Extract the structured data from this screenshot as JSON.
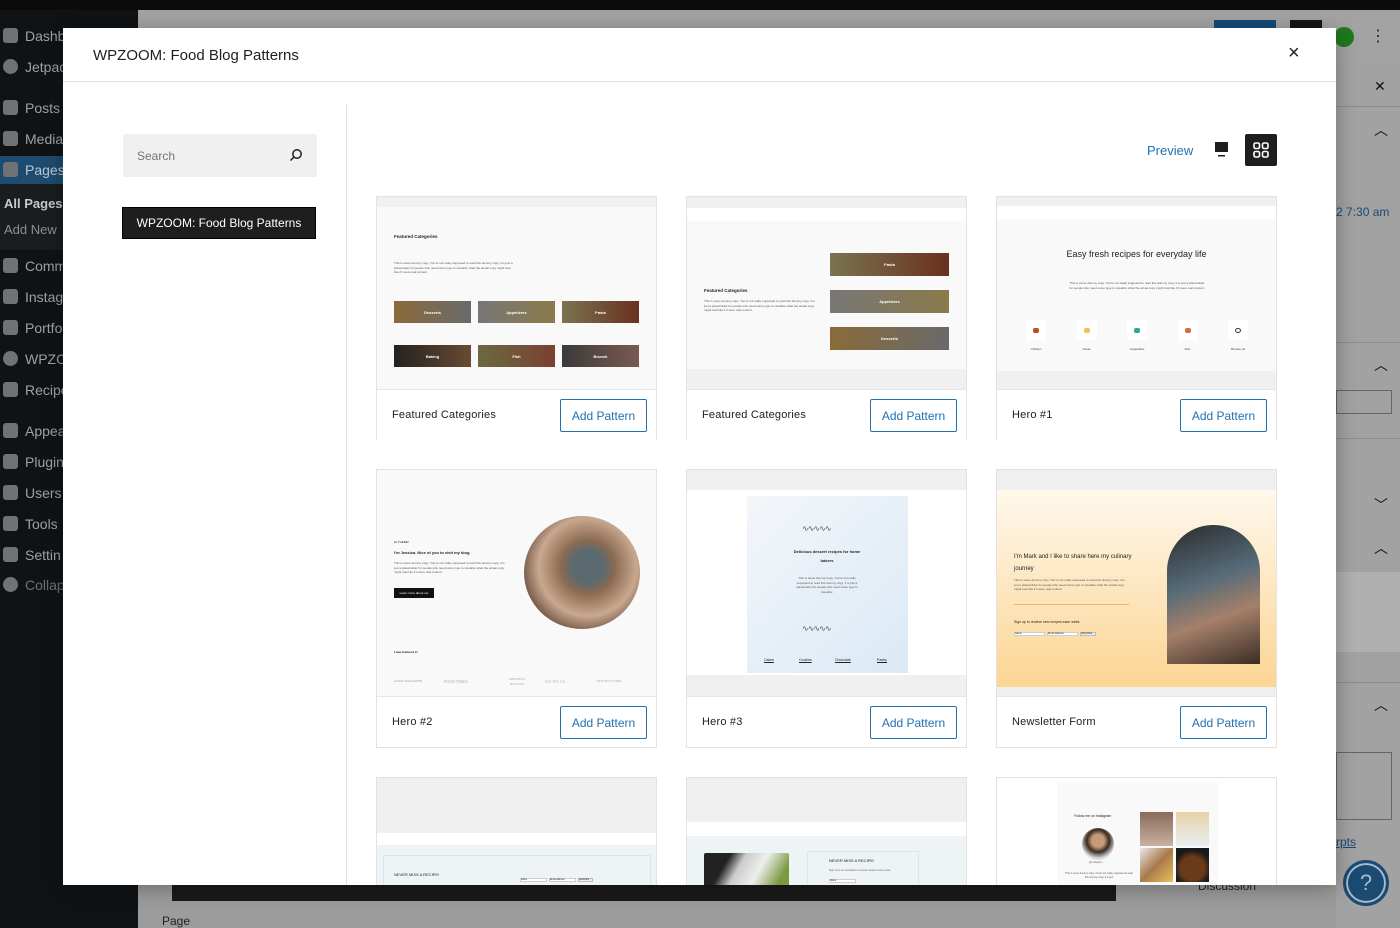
{
  "admin_menu": {
    "items": [
      "Dashb",
      "Jetpac",
      "Posts",
      "Media",
      "Pages",
      "Comm",
      "Instag",
      "Portfo",
      "WPZO",
      "Recipe",
      "Appea",
      "Plugin",
      "Users",
      "Tools",
      "Settin",
      "Collaps"
    ],
    "submenu": [
      "All Pages",
      "Add New"
    ]
  },
  "editor_bg": {
    "time": "2 7:30 am",
    "excerpt_link": "rpts",
    "discussion": "Discussion",
    "page_tab": "Page",
    "help": "?"
  },
  "modal": {
    "title": "WPZOOM: Food Blog Patterns",
    "close": "×"
  },
  "search": {
    "placeholder": "Search"
  },
  "categories": [
    {
      "label": "WPZOOM: Food Blog Patterns",
      "selected": true
    }
  ],
  "toolbar": {
    "preview_label": "Preview",
    "view_mode": "grid"
  },
  "add_label": "Add Pattern",
  "patterns": [
    {
      "name": "Featured Categories",
      "heading": "Featured Categories",
      "body": "This is some dummy copy. You're not really supposed to read this dummy copy, it is just a placeholder for people who need some type to visualize what the actual copy might look like if it were real content.",
      "tiles": [
        "Desserts",
        "Appetizers",
        "Pasta",
        "Baking",
        "Fish",
        "Brunch"
      ]
    },
    {
      "name": "Featured Categories",
      "heading": "Featured Categories",
      "body": "This is some dummy copy. You're not really supposed to read this dummy copy, it is just a placeholder for people who need some type to visualize what the actual copy might look like if it were real content.",
      "tiles": [
        "Pasta",
        "Appetizers",
        "Desserts"
      ]
    },
    {
      "name": "Hero #1",
      "heading": "Easy fresh recipes for everyday life",
      "body": "This is some dummy copy. You're not really supposed to read this dummy copy, it is just a placeholder for people who need some type to visualize what the actual copy might look like if it were real content.",
      "icons": [
        "Chicken",
        "Pasta",
        "Vegetables",
        "Fish",
        "Browse all"
      ]
    },
    {
      "name": "Hero #2",
      "kicker": "HI THERE!",
      "heading": "I'm Jessica. Nice of you to visit my blog.",
      "body": "This is some dummy copy. You're not really supposed to read this dummy copy, it is just a placeholder for people who need some type to visualize what the actual copy might look like if it were real content.",
      "button": "Learn more about me",
      "featured": "I was featured in",
      "logos": [
        "DAILY MAGAZINE",
        "FOOD TIMES",
        "MORNING BOSTON",
        "RECIPE 101",
        "TRH NETWORK"
      ]
    },
    {
      "name": "Hero #3",
      "heading": "Delicious dessert recipes for home bakers",
      "body": "This is some dummy copy. You're not really supposed to read this dummy copy, it is just a placeholder for people who need some type to visualize.",
      "links": [
        "Cakes",
        "Cookies",
        "Chocolate",
        "Pastry"
      ]
    },
    {
      "name": "Newsletter Form",
      "heading": "I'm Mark and I like to share here my culinary journey",
      "body": "This is some dummy copy. You're not really supposed to read this dummy copy, it is just a placeholder for people who need some type to visualize what the actual copy might look like if it were real content.",
      "signup": "Sign up to receive new recipes each week.",
      "name_ph": "Name",
      "email_ph": "Email address",
      "subscribe": "Subscribe"
    },
    {
      "heading": "NEVER MISS A RECIPE!",
      "name_ph": "Name",
      "email_ph": "Email address",
      "subscribe": "Subscribe"
    },
    {
      "heading": "NEVER MISS A RECIPE!",
      "body": "Sign up to our newsletter to receive recipes every week.",
      "name_ph": "Name"
    },
    {
      "heading": "Follow me on Instagram",
      "handle": "@instagram",
      "body": "This is some dummy copy. You're not really supposed to read this dummy copy, it is just"
    }
  ],
  "colors": {
    "accent": "#2271b1",
    "dark": "#1e1e1e",
    "newsletter_bg_top": "#fff6e6",
    "newsletter_bg_bottom": "#fbd593"
  }
}
